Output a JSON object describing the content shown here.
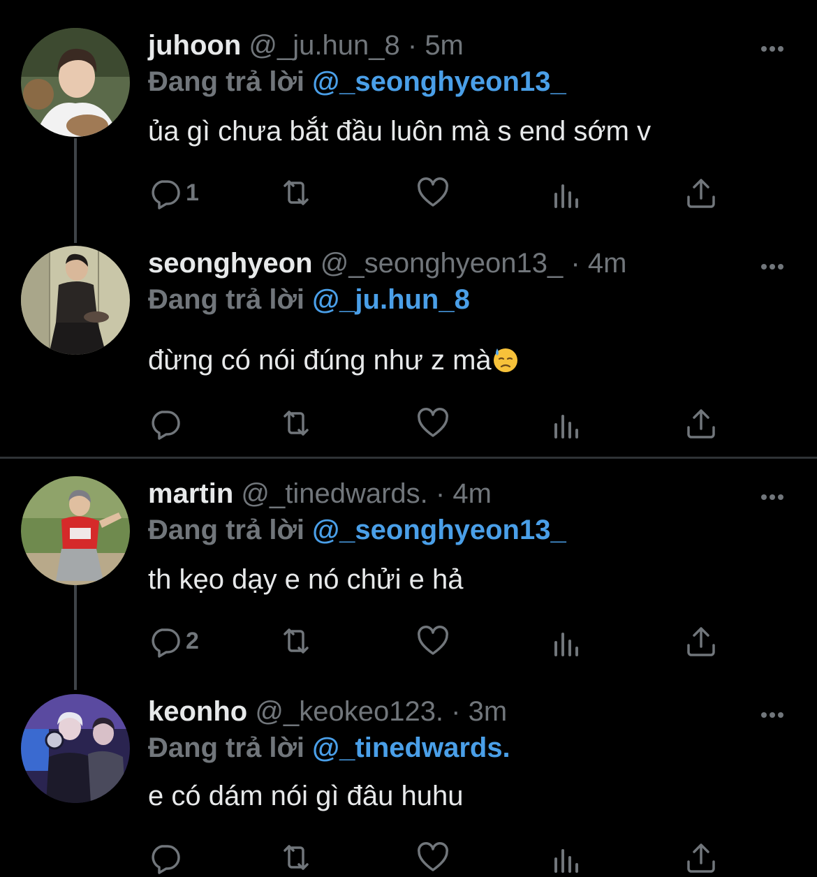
{
  "reply_prefix": "Đang trả lời",
  "colors": {
    "background": "#000000",
    "name": "#e7e9ea",
    "secondary": "#71767b",
    "mention": "#4a9fe8",
    "thread_line": "#3f4448",
    "divider": "#2f3336"
  },
  "icons": [
    "reply-icon",
    "retweet-icon",
    "like-icon",
    "views-icon",
    "share-icon",
    "more-icon",
    "sweat-emoji-icon"
  ],
  "tweets": [
    {
      "name": "juhoon",
      "handle": "@_ju.hun_8",
      "separator": "·",
      "time": "5m",
      "reply_to": "@_seonghyeon13_",
      "text": "ủa gì chưa bắt đầu luôn mà s end sớm v",
      "reply_count": "1"
    },
    {
      "name": "seonghyeon",
      "handle": "@_seonghyeon13_",
      "separator": "·",
      "time": "4m",
      "reply_to": "@_ju.hun_8",
      "text": "đừng có nói đúng như z mà",
      "reply_count": ""
    },
    {
      "name": "martin",
      "handle": "@_tinedwards.",
      "separator": "·",
      "time": "4m",
      "reply_to": "@_seonghyeon13_",
      "text": "th kẹo dạy e nó chửi e hả",
      "reply_count": "2"
    },
    {
      "name": "keonho",
      "handle": "@_keokeo123.",
      "separator": "·",
      "time": "3m",
      "reply_to": "@_tinedwards.",
      "text": "e có dám nói gì đâu huhu",
      "reply_count": ""
    }
  ]
}
